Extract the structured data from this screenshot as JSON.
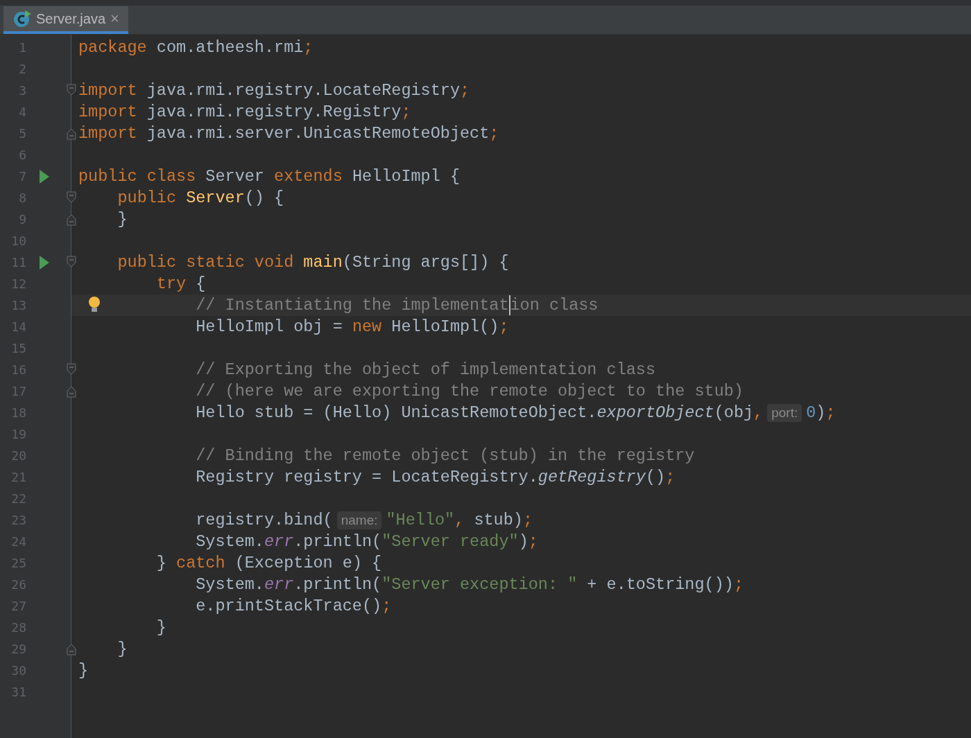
{
  "tab": {
    "label": "Server.java",
    "selected": true,
    "close": "×"
  },
  "lines": [
    {
      "n": "1",
      "tokens": [
        {
          "kind": "kw",
          "t": "package"
        },
        {
          "kind": "plain",
          "t": " com.atheesh.rmi"
        },
        {
          "kind": "punct",
          "t": ";"
        }
      ]
    },
    {
      "n": "2"
    },
    {
      "n": "3",
      "fold_start": true,
      "tokens": [
        {
          "kind": "kw",
          "t": "import"
        },
        {
          "kind": "plain",
          "t": " java.rmi.registry.LocateRegistry"
        },
        {
          "kind": "punct",
          "t": ";"
        }
      ]
    },
    {
      "n": "4",
      "tokens": [
        {
          "kind": "kw",
          "t": "import"
        },
        {
          "kind": "plain",
          "t": " java.rmi.registry.Registry"
        },
        {
          "kind": "punct",
          "t": ";"
        }
      ]
    },
    {
      "n": "5",
      "fold_end": true,
      "tokens": [
        {
          "kind": "kw",
          "t": "import"
        },
        {
          "kind": "plain",
          "t": " java.rmi.server.UnicastRemoteObject"
        },
        {
          "kind": "punct",
          "t": ";"
        }
      ]
    },
    {
      "n": "6"
    },
    {
      "n": "7",
      "run": true,
      "tokens": [
        {
          "kind": "kw",
          "t": "public class"
        },
        {
          "kind": "plain",
          "t": " Server "
        },
        {
          "kind": "kw",
          "t": "extends"
        },
        {
          "kind": "plain",
          "t": " HelloImpl {"
        }
      ]
    },
    {
      "n": "8",
      "fold_start": true,
      "tokens": [
        {
          "kind": "kw",
          "t": "    public"
        },
        {
          "kind": "decl",
          "t": " Server"
        },
        {
          "kind": "plain",
          "t": "() {"
        }
      ]
    },
    {
      "n": "9",
      "fold_end": true,
      "tokens": [
        {
          "kind": "plain",
          "t": "    }"
        }
      ]
    },
    {
      "n": "10"
    },
    {
      "n": "11",
      "run": true,
      "fold_start": true,
      "tokens": [
        {
          "kind": "kw",
          "t": "    public static void"
        },
        {
          "kind": "decl",
          "t": " main"
        },
        {
          "kind": "plain",
          "t": "(String args[]) {"
        }
      ]
    },
    {
      "n": "12",
      "tokens": [
        {
          "kind": "kw",
          "t": "        try"
        },
        {
          "kind": "plain",
          "t": " {"
        }
      ]
    },
    {
      "n": "13",
      "current": true,
      "bulb": true,
      "tokens": [
        {
          "kind": "comment",
          "t": "            // Instantiating the implementat"
        },
        {
          "kind": "caret"
        },
        {
          "kind": "comment",
          "t": "ion class"
        }
      ]
    },
    {
      "n": "14",
      "tokens": [
        {
          "kind": "plain",
          "t": "            HelloImpl obj = "
        },
        {
          "kind": "kw",
          "t": "new"
        },
        {
          "kind": "plain",
          "t": " HelloImpl()"
        },
        {
          "kind": "punct",
          "t": ";"
        }
      ]
    },
    {
      "n": "15"
    },
    {
      "n": "16",
      "fold_start": true,
      "tokens": [
        {
          "kind": "comment",
          "t": "            // Exporting the object of implementation class"
        }
      ]
    },
    {
      "n": "17",
      "fold_end": true,
      "tokens": [
        {
          "kind": "comment",
          "t": "            // (here we are exporting the remote object to the stub)"
        }
      ]
    },
    {
      "n": "18",
      "tokens": [
        {
          "kind": "plain",
          "t": "            Hello stub = (Hello) UnicastRemoteObject."
        },
        {
          "kind": "static",
          "t": "exportObject"
        },
        {
          "kind": "plain",
          "t": "(obj"
        },
        {
          "kind": "punct",
          "t": ","
        },
        {
          "kind": "hint",
          "t": "port:"
        },
        {
          "kind": "num",
          "t": "0"
        },
        {
          "kind": "plain",
          "t": ")"
        },
        {
          "kind": "punct",
          "t": ";"
        }
      ]
    },
    {
      "n": "19"
    },
    {
      "n": "20",
      "tokens": [
        {
          "kind": "comment",
          "t": "            // Binding the remote object (stub) in the registry"
        }
      ]
    },
    {
      "n": "21",
      "tokens": [
        {
          "kind": "plain",
          "t": "            Registry registry = LocateRegistry."
        },
        {
          "kind": "static",
          "t": "getRegistry"
        },
        {
          "kind": "plain",
          "t": "()"
        },
        {
          "kind": "punct",
          "t": ";"
        }
      ]
    },
    {
      "n": "22"
    },
    {
      "n": "23",
      "tokens": [
        {
          "kind": "plain",
          "t": "            registry.bind("
        },
        {
          "kind": "hint",
          "t": "name:"
        },
        {
          "kind": "str",
          "t": "\"Hello\""
        },
        {
          "kind": "punct",
          "t": ","
        },
        {
          "kind": "plain",
          "t": " stub)"
        },
        {
          "kind": "punct",
          "t": ";"
        }
      ]
    },
    {
      "n": "24",
      "tokens": [
        {
          "kind": "plain",
          "t": "            System."
        },
        {
          "kind": "field",
          "t": "err"
        },
        {
          "kind": "plain",
          "t": ".println("
        },
        {
          "kind": "str",
          "t": "\"Server ready\""
        },
        {
          "kind": "plain",
          "t": ")"
        },
        {
          "kind": "punct",
          "t": ";"
        }
      ]
    },
    {
      "n": "25",
      "tokens": [
        {
          "kind": "plain",
          "t": "        } "
        },
        {
          "kind": "kw",
          "t": "catch"
        },
        {
          "kind": "plain",
          "t": " (Exception e) {"
        }
      ]
    },
    {
      "n": "26",
      "tokens": [
        {
          "kind": "plain",
          "t": "            System."
        },
        {
          "kind": "field",
          "t": "err"
        },
        {
          "kind": "plain",
          "t": ".println("
        },
        {
          "kind": "str",
          "t": "\"Server exception: \""
        },
        {
          "kind": "plain",
          "t": " + e.toString())"
        },
        {
          "kind": "punct",
          "t": ";"
        }
      ]
    },
    {
      "n": "27",
      "tokens": [
        {
          "kind": "plain",
          "t": "            e.printStackTrace()"
        },
        {
          "kind": "punct",
          "t": ";"
        }
      ]
    },
    {
      "n": "28",
      "tokens": [
        {
          "kind": "plain",
          "t": "        }"
        }
      ]
    },
    {
      "n": "29",
      "fold_end": true,
      "tokens": [
        {
          "kind": "plain",
          "t": "    }"
        }
      ]
    },
    {
      "n": "30",
      "tokens": [
        {
          "kind": "plain",
          "t": "}"
        }
      ]
    },
    {
      "n": "31"
    }
  ]
}
